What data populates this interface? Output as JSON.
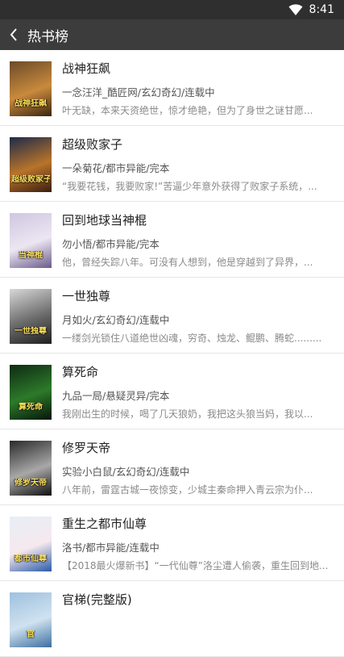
{
  "status_bar": {
    "time": "8:41"
  },
  "header": {
    "title": "热书榜"
  },
  "books": [
    {
      "title": "战神狂飙",
      "meta": "一念汪洋_酷匠网/玄幻奇幻/连载中",
      "desc": "叶无缺，本来天资绝世，惊才绝艳，但为了身世之谜甘愿...",
      "cover_text": "战神狂飙",
      "cover_colors": [
        "#6b4a2a",
        "#c98a3c",
        "#3a2612"
      ]
    },
    {
      "title": "超级败家子",
      "meta": "一朵菊花/都市异能/完本",
      "desc": "“我要花钱，我要败家!”苦逼少年意外获得了败家子系统，...",
      "cover_text": "超级败家子",
      "cover_colors": [
        "#1e2a4a",
        "#b8742a",
        "#3a1e10"
      ]
    },
    {
      "title": "回到地球当神棍",
      "meta": "勿小悟/都市异能/完本",
      "desc": "他，曾经失踪八年。可没有人想到，他是穿越到了异界，...",
      "cover_text": "当神棍",
      "cover_colors": [
        "#cfc6e0",
        "#ece6f2",
        "#6b5a8a"
      ]
    },
    {
      "title": "一世独尊",
      "meta": "月如火/玄幻奇幻/连载中",
      "desc": "一缕剑光锁住八道绝世凶魂，穷奇、烛龙、鲲鹏、腾蛇.........",
      "cover_text": "一世独尊",
      "cover_colors": [
        "#d8d8d8",
        "#6a6a6a",
        "#1f1f1f"
      ]
    },
    {
      "title": "算死命",
      "meta": "九品一局/悬疑灵异/完本",
      "desc": "我刚出生的时候，喝了几天狼奶，我把这头狼当妈，我以...",
      "cover_text": "算死命",
      "cover_colors": [
        "#0f2a14",
        "#2d7a2a",
        "#06140a"
      ]
    },
    {
      "title": "修罗天帝",
      "meta": "实验小白鼠/玄幻奇幻/连载中",
      "desc": "八年前，雷霆古城一夜惊变，少城主秦命押入青云宗为仆...",
      "cover_text": "修罗天帝",
      "cover_colors": [
        "#2a2a2a",
        "#a8a8a8",
        "#0e0e0e"
      ]
    },
    {
      "title": "重生之都市仙尊",
      "meta": "洛书/都市异能/连载中",
      "desc": "【2018最火爆新书】“一代仙尊”洛尘遭人偷袭，重生回到地...",
      "cover_text": "都市仙尊",
      "cover_colors": [
        "#e8eef6",
        "#f5e9ee",
        "#2a5aa8"
      ]
    },
    {
      "title": "官梯(完整版)",
      "meta": "",
      "desc": "",
      "cover_text": "官",
      "cover_colors": [
        "#9ec0de",
        "#cfe2f0",
        "#3c6e9e"
      ]
    }
  ]
}
